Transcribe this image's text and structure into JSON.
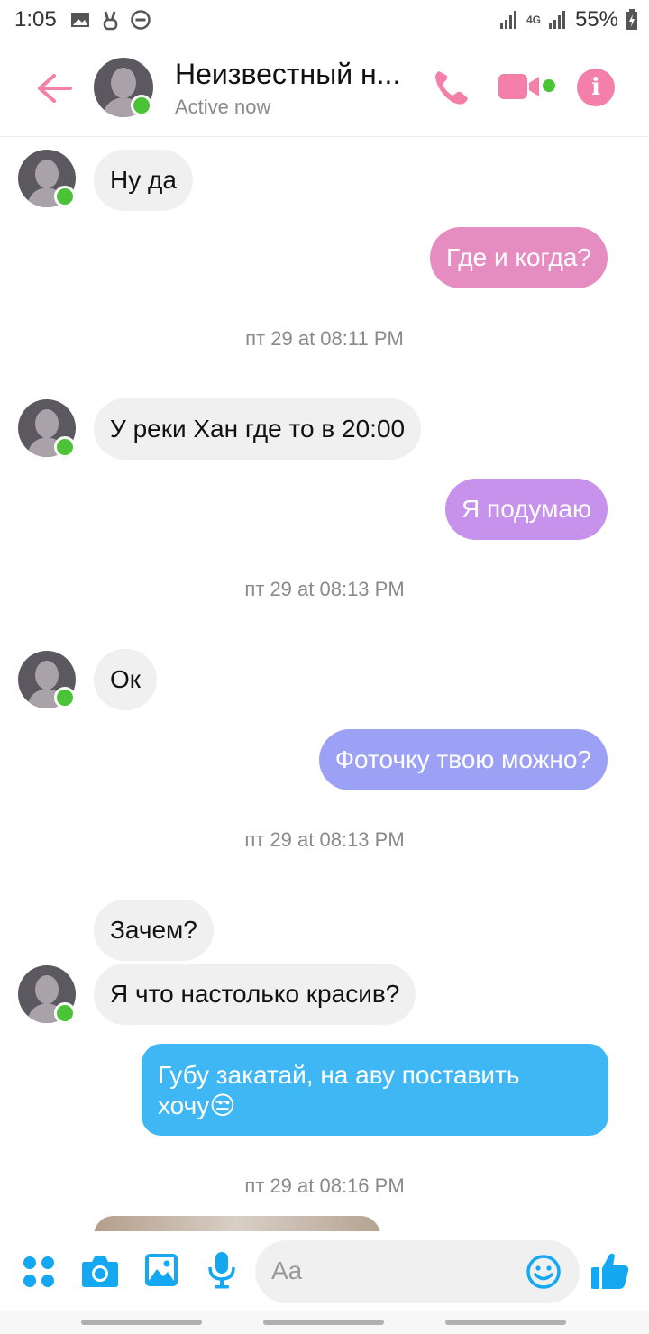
{
  "status_bar": {
    "time": "1:05",
    "battery": "55%",
    "network": "4G"
  },
  "header": {
    "contact_name": "Неизвестный н...",
    "status": "Active now",
    "accent_color": "#f47fa8"
  },
  "messages": [
    {
      "type": "in",
      "text": "Ну да"
    },
    {
      "type": "out",
      "text": "Где и когда?",
      "color": "#e58dc0"
    },
    {
      "type": "time",
      "text": "пт 29 at 08:11 PM"
    },
    {
      "type": "in",
      "text": "У реки Хан где то в 20:00"
    },
    {
      "type": "out",
      "text": "Я подумаю",
      "color": "#c692ec"
    },
    {
      "type": "time",
      "text": "пт 29 at 08:13 PM"
    },
    {
      "type": "in",
      "text": "Ок"
    },
    {
      "type": "out",
      "text": "Фоточку твою можно?",
      "color": "#9ca1f6"
    },
    {
      "type": "time",
      "text": "пт 29 at 08:13 PM"
    },
    {
      "type": "in",
      "text": "Зачем?"
    },
    {
      "type": "in",
      "text": "Я что настолько красив?"
    },
    {
      "type": "out",
      "text": "Губу закатай, на аву поставить",
      "text2": "хочу😒",
      "color": "#3fb7f4"
    },
    {
      "type": "time",
      "text": "пт 29 at 08:16 PM"
    }
  ],
  "composer": {
    "placeholder": "Aa",
    "icon_color": "#14a8f2"
  }
}
